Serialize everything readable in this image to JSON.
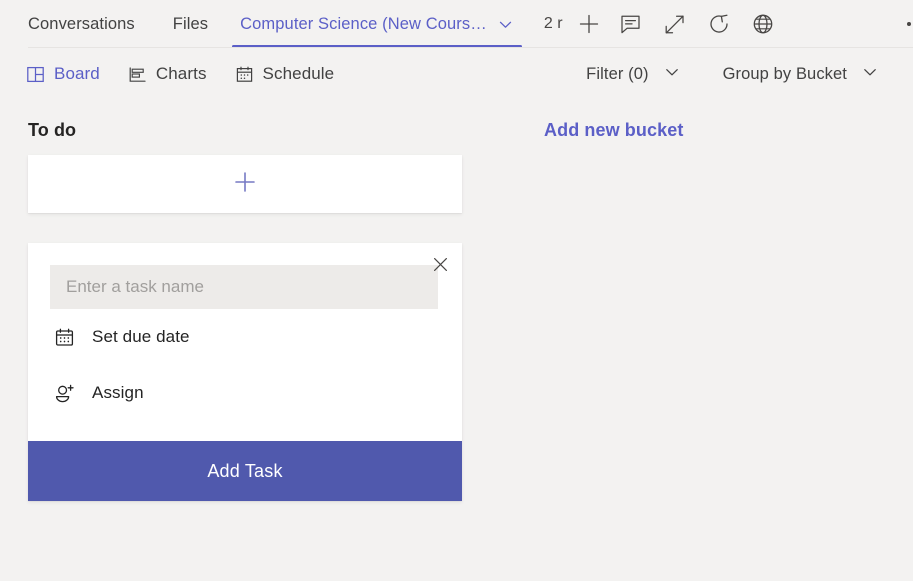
{
  "tabstrip": {
    "tabs": [
      {
        "label": "Conversations",
        "active": false,
        "has_chevron": false
      },
      {
        "label": "Files",
        "active": false,
        "has_chevron": false
      },
      {
        "label": "Computer Science (New Cours…",
        "active": true,
        "has_chevron": true
      }
    ],
    "overflow_label": "2 r",
    "actions": [
      {
        "name": "add-tab-button",
        "icon": "plus-icon"
      },
      {
        "name": "chat-button",
        "icon": "chat-bubble-icon"
      },
      {
        "name": "expand-button",
        "icon": "expand-diagonal-icon"
      },
      {
        "name": "refresh-button",
        "icon": "refresh-icon"
      },
      {
        "name": "open-in-browser-button",
        "icon": "globe-icon"
      },
      {
        "name": "more-options-button",
        "icon": "ellipsis-icon"
      }
    ]
  },
  "subnav": {
    "views": [
      {
        "label": "Board",
        "icon": "board-grid-icon",
        "active": true
      },
      {
        "label": "Charts",
        "icon": "bar-chart-icon",
        "active": false
      },
      {
        "label": "Schedule",
        "icon": "calendar-icon",
        "active": false
      }
    ],
    "filter_label": "Filter (0)",
    "group_label": "Group by Bucket"
  },
  "board": {
    "bucket": {
      "title": "To do",
      "add_card_icon": "plus-icon"
    },
    "new_task": {
      "close_icon": "close-icon",
      "name_placeholder": "Enter a task name",
      "name_value": "",
      "due_date_label": "Set due date",
      "due_date_icon": "calendar-icon",
      "assign_label": "Assign",
      "assign_icon": "person-add-icon",
      "submit_label": "Add Task"
    },
    "add_bucket_label": "Add new bucket"
  },
  "colors": {
    "accent": "#5b5fc7",
    "button": "#5059ad",
    "background": "#f3f2f1",
    "card": "#ffffff",
    "input": "#edebe9",
    "text": "#252423"
  }
}
